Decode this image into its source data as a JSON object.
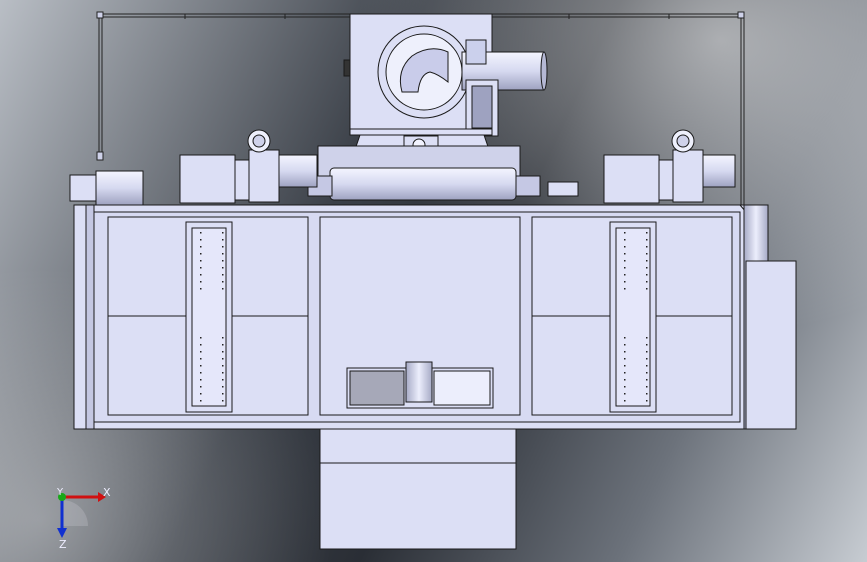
{
  "viewport": {
    "view": "front-orthographic",
    "background_style": "gradient-dark-gray"
  },
  "triad": {
    "x_label": "X",
    "y_label": "Y",
    "z_label": "Z",
    "colors": {
      "x": "#d01010",
      "y": "#18a818",
      "z": "#1030d0"
    }
  },
  "model": {
    "fill_color": "#dcdff5",
    "edge_color": "#1a1a1a",
    "shadow_color": "#a9acc8",
    "panel_dark_color": "#a6a8b8"
  }
}
